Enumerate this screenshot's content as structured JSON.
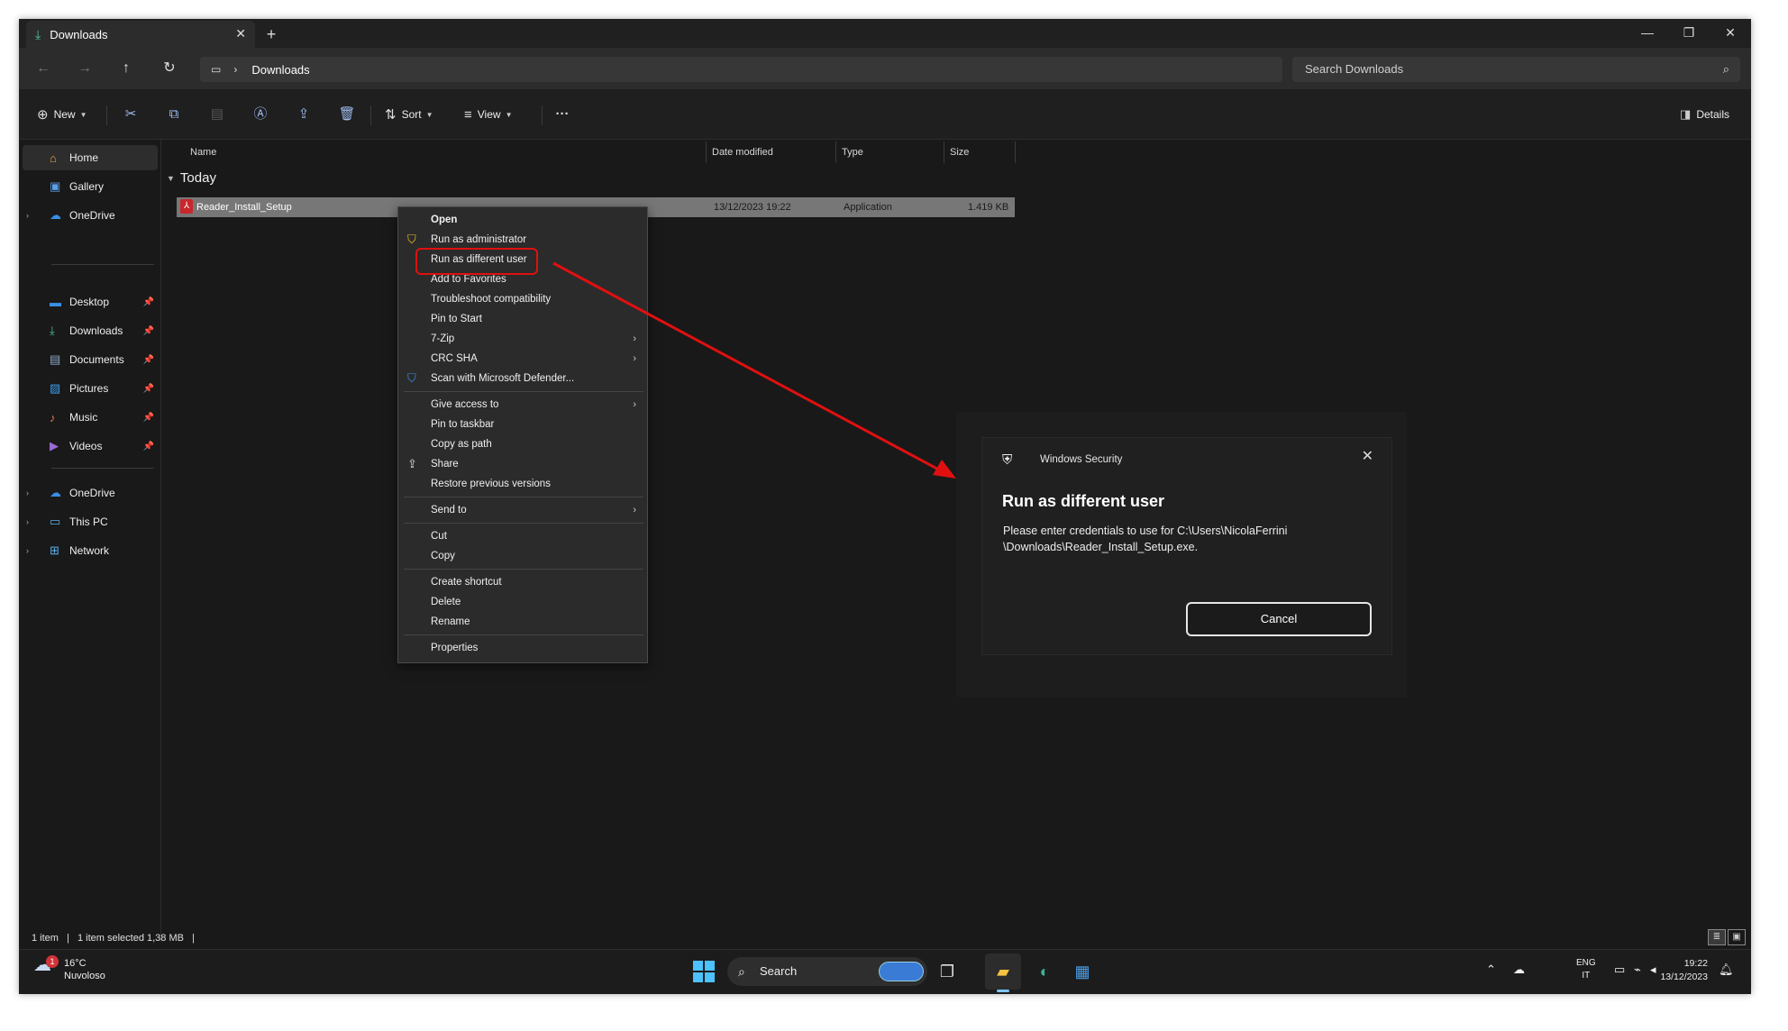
{
  "tab": {
    "title": "Downloads"
  },
  "address": {
    "crumb": "Downloads",
    "search_placeholder": "Search Downloads"
  },
  "toolbar": {
    "new_label": "New",
    "sort_label": "Sort",
    "view_label": "View",
    "details_label": "Details"
  },
  "sidebar": {
    "items": [
      "Home",
      "Gallery",
      "OneDrive",
      "Desktop",
      "Downloads",
      "Documents",
      "Pictures",
      "Music",
      "Videos",
      "OneDrive",
      "This PC",
      "Network"
    ]
  },
  "columns": {
    "name": "Name",
    "date": "Date modified",
    "type": "Type",
    "size": "Size"
  },
  "group_label": "Today",
  "file": {
    "name": "Reader_Install_Setup",
    "date": "13/12/2023 19:22",
    "type": "Application",
    "size": "1.419 KB"
  },
  "context_menu": {
    "items": [
      "Open",
      "Run as administrator",
      "Run as different user",
      "Add to Favorites",
      "Troubleshoot compatibility",
      "Pin to Start",
      "7-Zip",
      "CRC SHA",
      "Scan with Microsoft Defender...",
      "Give access to",
      "Pin to taskbar",
      "Copy as path",
      "Share",
      "Restore previous versions",
      "Send to",
      "Cut",
      "Copy",
      "Create shortcut",
      "Delete",
      "Rename",
      "Properties"
    ]
  },
  "dialog": {
    "app_name": "Windows Security",
    "title": "Run as different user",
    "message_line1": "Please enter credentials to use for C:\\Users\\NicolaFerrini",
    "message_line2": "\\Downloads\\Reader_Install_Setup.exe.",
    "cancel_label": "Cancel"
  },
  "status": {
    "items": "1 item",
    "selected": "1 item selected  1,38 MB"
  },
  "taskbar": {
    "temperature": "16°C",
    "weather": "Nuvoloso",
    "weather_badge": "1",
    "search_label": "Search",
    "lang_top": "ENG",
    "lang_bottom": "IT",
    "time": "19:22",
    "date": "13/12/2023"
  },
  "colors": {
    "highlight_red": "#e01010",
    "accent_blue": "#4cc2ff",
    "selected_row": "#777777"
  }
}
